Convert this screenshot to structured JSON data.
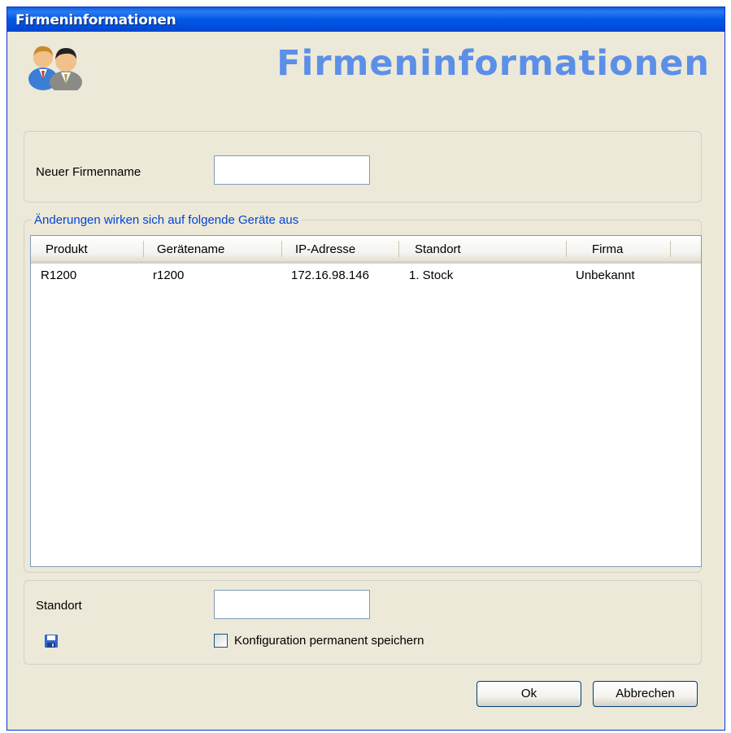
{
  "window": {
    "title": "Firmeninformationen"
  },
  "banner": {
    "title": "Firmeninformationen",
    "icon": "users-icon"
  },
  "company": {
    "label": "Neuer Firmenname",
    "value": ""
  },
  "devices": {
    "legend": "Änderungen wirken sich auf folgende Geräte aus",
    "columns": [
      "Produkt",
      "Gerätename",
      "IP-Adresse",
      "Standort",
      "Firma"
    ],
    "rows": [
      [
        "R1200",
        "r1200",
        "172.16.98.146",
        "1. Stock",
        "Unbekannt"
      ]
    ]
  },
  "location": {
    "label": "Standort",
    "value": "",
    "save_icon": "floppy-disk-icon",
    "checkbox_label": "Konfiguration permanent speichern",
    "checkbox_checked": false
  },
  "buttons": {
    "ok": "Ok",
    "cancel": "Abbrechen"
  },
  "colors": {
    "titlebar": "#0058e6",
    "dialog": "#ece9d8",
    "banner_text": "#5b8fe8",
    "legend": "#0046d5"
  }
}
